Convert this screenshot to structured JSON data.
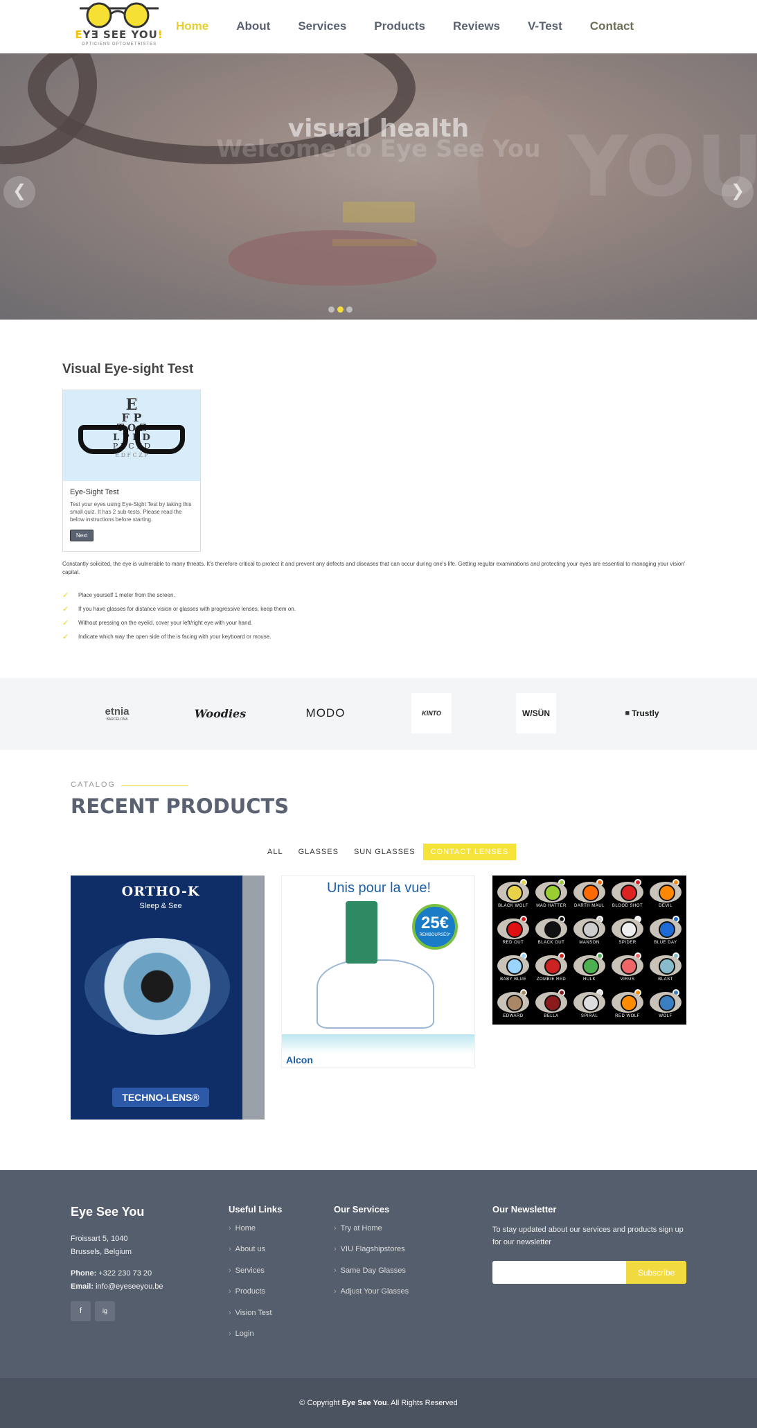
{
  "header": {
    "logo_text_start": "E",
    "logo_text_mid": "YƎ SEE YOU",
    "logo_text_end": "!",
    "logo_sub": "OPTICIENS OPTOMETRISTES",
    "nav": [
      "Home",
      "About",
      "Services",
      "Products",
      "Reviews",
      "V-Test",
      "Contact"
    ]
  },
  "hero": {
    "title_front": "visual health",
    "title_back": "Welcome to Eye See You",
    "watermark": "YOU!"
  },
  "eyetest": {
    "section_title": "Visual Eye-sight Test",
    "chart_rows": [
      "E",
      "F P",
      "T O Z",
      "L P E D",
      "P E C F D",
      "E D F C Z P"
    ],
    "card_title": "Eye-Sight Test",
    "card_text": "Test your eyes using Eye-Sight Test by taking this small quiz. It has 2 sub-tests. Please read the below instructions before starting.",
    "card_button": "Next",
    "intro": "Constantly solicited, the eye is vulnerable to many threats. It's therefore critical to protect it and prevent any defects and diseases that can occur during one's life. Getting regular examinations and protecting your eyes are essential to managing your vision' capital.",
    "steps": [
      "Place yourself 1 meter from the screen.",
      "If you have glasses for distance vision or glasses with progressive lenses, keep them on.",
      "Without pressing on the eyelid, cover your left/right eye with your hand.",
      "Indicate which way the open side of the is facing with your keyboard or mouse."
    ]
  },
  "brands": [
    "etnia",
    "Woodies",
    "MODO",
    "KINTO",
    "W/SÜN",
    "Trustly"
  ],
  "brand_sub": "BARCELONA",
  "products": {
    "catalog": "CATALOG",
    "title": "RECENT PRODUCTS",
    "filters": [
      "ALL",
      "GLASSES",
      "SUN GLASSES",
      "CONTACT LENSES"
    ],
    "p1_title": "ORTHO-K",
    "p1_sub": "Sleep & See",
    "p1_tag": "TECHNO-LENS®",
    "p2_headline": "Unis pour la vue!",
    "p2_badge_value": "25€",
    "p2_badge_label": "REMBOURSÉS*",
    "p2_brand": "Alcon",
    "p3_names": [
      "BLACK WOLF",
      "MAD HATTER",
      "DARTH MAUL",
      "BLOOD SHOT",
      "DEVIL",
      "RED OUT",
      "BLACK OUT",
      "MANSON",
      "SPIDER",
      "BLUE DAY",
      "BABY BLUE",
      "ZOMBIE RED",
      "HULK",
      "VIRUS",
      "BLAST",
      "EDWARD",
      "BELLA",
      "SPIRAL",
      "RED WOLF",
      "WOLF"
    ],
    "p3_colors": [
      "#e8d24a",
      "#9acd32",
      "#ff6a00",
      "#d22",
      "#f80",
      "#d11",
      "#111",
      "#ccc",
      "#eee",
      "#1e6bd6",
      "#9ad4ff",
      "#c22",
      "#4caf50",
      "#e66",
      "#8bc",
      "#a86",
      "#8b1a1a",
      "#ddd",
      "#ff8c00",
      "#3a7fc1"
    ]
  },
  "footer": {
    "brand": "Eye See You",
    "address_line1": "Froissart 5, 1040",
    "address_line2": "Brussels, Belgium",
    "phone_label": "Phone:",
    "phone": "+322 230 73 20",
    "email_label": "Email:",
    "email": "info@eyeseeyou.be",
    "social": [
      "f",
      "ig"
    ],
    "useful_title": "Useful Links",
    "useful": [
      "Home",
      "About us",
      "Services",
      "Products",
      "Vision Test",
      "Login"
    ],
    "services_title": "Our Services",
    "services": [
      "Try at Home",
      "VIU Flagshipstores",
      "Same Day Glasses",
      "Adjust Your Glasses"
    ],
    "newsletter_title": "Our Newsletter",
    "newsletter_text": "To stay updated about our services and products sign up for our newsletter",
    "subscribe": "Subscribe",
    "copyright_pre": "© Copyright ",
    "copyright_brand": "Eye See You",
    "copyright_post": ". All Rights Reserved"
  }
}
